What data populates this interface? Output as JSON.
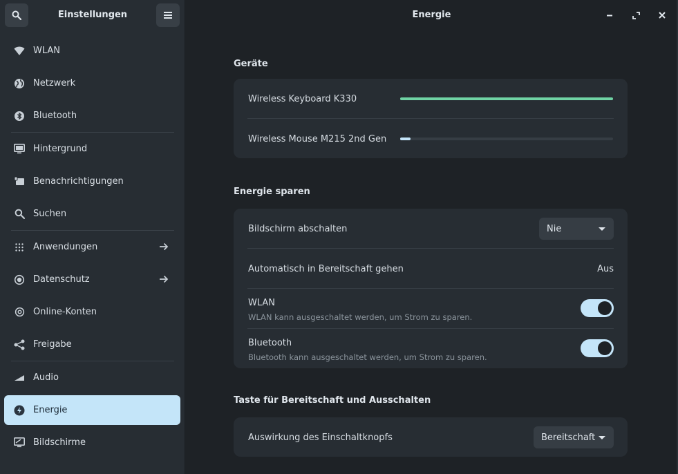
{
  "sidebar": {
    "title": "Einstellungen",
    "items": [
      {
        "label": "WLAN",
        "icon": "wifi-icon"
      },
      {
        "label": "Netzwerk",
        "icon": "globe-icon"
      },
      {
        "label": "Bluetooth",
        "icon": "bluetooth-icon"
      },
      {
        "label": "Hintergrund",
        "icon": "display-background-icon"
      },
      {
        "label": "Benachrichtigungen",
        "icon": "notification-icon"
      },
      {
        "label": "Suchen",
        "icon": "search-icon"
      },
      {
        "label": "Anwendungen",
        "icon": "grid-icon"
      },
      {
        "label": "Datenschutz",
        "icon": "privacy-icon"
      },
      {
        "label": "Online-Konten",
        "icon": "at-sign-icon"
      },
      {
        "label": "Freigabe",
        "icon": "share-icon"
      },
      {
        "label": "Audio",
        "icon": "audio-icon"
      },
      {
        "label": "Energie",
        "icon": "power-icon"
      },
      {
        "label": "Bildschirme",
        "icon": "monitor-icon"
      }
    ]
  },
  "main": {
    "title": "Energie",
    "devices": {
      "title": "Geräte",
      "items": [
        {
          "name": "Wireless Keyboard K330",
          "level": 1.0
        },
        {
          "name": "Wireless Mouse M215 2nd Gen",
          "level": 0.05
        }
      ]
    },
    "power_saving": {
      "title": "Energie sparen",
      "screen_off_label": "Bildschirm abschalten",
      "screen_off_value": "Nie",
      "auto_suspend_label": "Automatisch in Bereitschaft gehen",
      "auto_suspend_value": "Aus",
      "wlan_label": "WLAN",
      "wlan_sub": "WLAN kann ausgeschaltet werden, um Strom zu sparen.",
      "bt_label": "Bluetooth",
      "bt_sub": "Bluetooth kann ausgeschaltet werden, um Strom zu sparen."
    },
    "power_button": {
      "title": "Taste für Bereitschaft und Ausschalten",
      "label": "Auswirkung des Einschaltknopfs",
      "value": "Bereitschaft"
    }
  },
  "colors": {
    "accent": "#c4e5f9",
    "battery_full": "#6fd3a4"
  }
}
